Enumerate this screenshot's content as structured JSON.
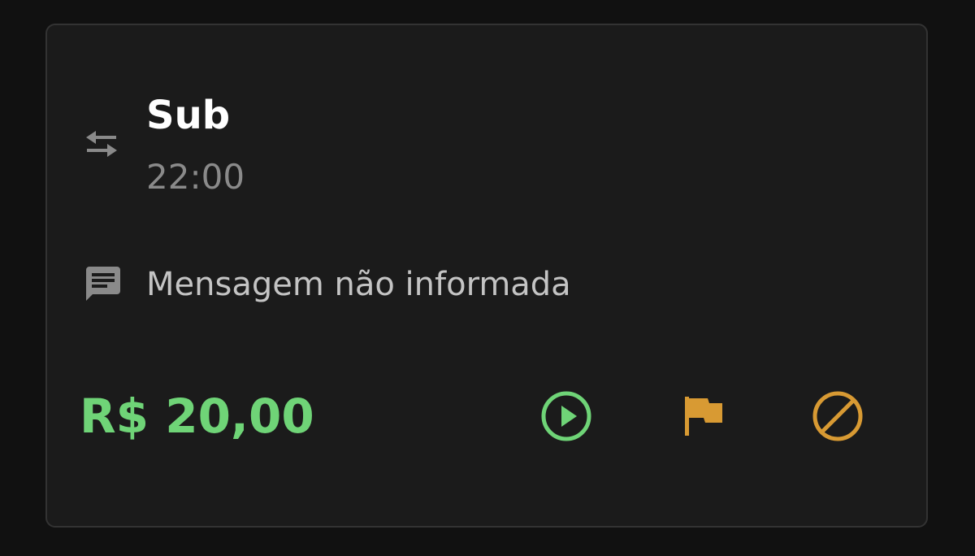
{
  "card": {
    "title": "Sub",
    "time": "22:00",
    "message": "Mensagem não informada",
    "amount": "R$ 20,00"
  },
  "icons": {
    "type": "swap-horiz-icon",
    "message": "chat-bubble-icon",
    "play": "play-circle-icon",
    "flag": "flag-icon",
    "block": "block-icon"
  },
  "colors": {
    "background": "#111111",
    "card": "#1b1b1b",
    "card_border": "#333333",
    "amount": "#6fd477",
    "play": "#6fd477",
    "flag": "#d89a33",
    "block": "#d89a33",
    "muted_icon": "#8a8a8a"
  }
}
